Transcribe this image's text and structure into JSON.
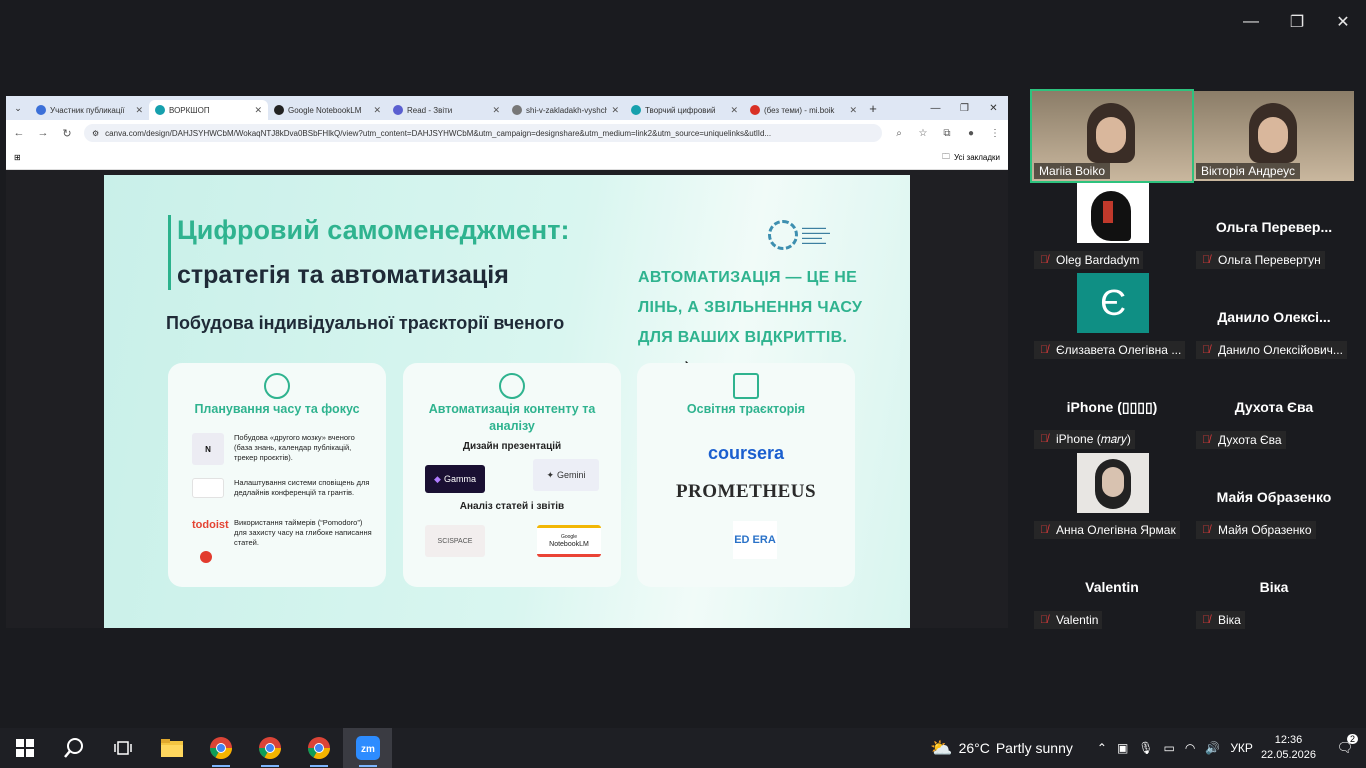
{
  "browser": {
    "tabs": [
      {
        "label": "Участник публикації",
        "color": "#3b6fd8",
        "active": false
      },
      {
        "label": "ВОРКШОП",
        "color": "#16a0ad",
        "active": true
      },
      {
        "label": "Google NotebookLM",
        "color": "#222222",
        "active": false
      },
      {
        "label": "Read - Звіти",
        "color": "#5a5fd0",
        "active": false
      },
      {
        "label": "shi-v-zakladakh-vyshch",
        "color": "#777777",
        "active": false
      },
      {
        "label": "Творчий цифровий",
        "color": "#16a0ad",
        "active": false
      },
      {
        "label": "(без теми) - mi.boik",
        "color": "#d93025",
        "active": false
      }
    ],
    "url": "canva.com/design/DAHJSYHWCbM/WokaqNTJ8kDva0BSbFHlkQ/view?utm_content=DAHJSYHWCbM&utm_campaign=designshare&utm_medium=link2&utm_source=uniquelinks&utlId...",
    "bookmarks_label": "Усі закладки"
  },
  "slide": {
    "title_line1": "Цифровий самоменеджмент:",
    "title_line2": "стратегія та автоматизація",
    "subtitle": "Побудова індивідуальної траєкторії вченого",
    "slogan": "АВТОМАТИЗАЦІЯ — ЦЕ НЕ ЛІНЬ, А ЗВІЛЬНЕННЯ ЧАСУ ДЛЯ ВАШИХ ВІДКРИТТІВ.",
    "card1": {
      "title": "Планування часу та фокус",
      "items": [
        {
          "icon_label": "N",
          "text": "Побудова «другого мозку» вченого (база знань, календар публікацій, трекер проєктів)."
        },
        {
          "icon_label": "",
          "text": "Налаштування системи сповіщень для дедлайнів конференцій та грантів."
        },
        {
          "icon_label": "todoist",
          "text": "Використання таймерів (“Pomodoro”) для захисту часу на глибоке написання статей."
        }
      ]
    },
    "card2": {
      "title": "Автоматизація контенту та аналізу",
      "section1": "Дизайн презентацій",
      "gamma": "Gamma",
      "gemini": "Gemini",
      "section2": "Аналіз статей і звітів",
      "scispace": "SCISPACE",
      "notebook": "NotebookLM",
      "notebook_small": "Google"
    },
    "card3": {
      "title": "Освітня траєкторія",
      "coursera": "coursera",
      "prometheus": "PROMETHEUS",
      "edera": "ED ERA"
    }
  },
  "participants": [
    {
      "name": "Mariia Boiko",
      "video": true,
      "active": true
    },
    {
      "name": "Вікторія Андреус",
      "video": true,
      "active": false
    },
    {
      "name": "Oleg Bardadym",
      "big": "",
      "avatar": "head"
    },
    {
      "name": "Ольга Перевертун",
      "big": "Ольга  Перевер..."
    },
    {
      "name": "Єлизавета Олегівна ...",
      "big": "",
      "avatar": "e"
    },
    {
      "name": "Данило Олексійович...",
      "big": "Данило  Олексі..."
    },
    {
      "name": "iPhone (𝑚𝑎𝑟𝑦)",
      "big": "iPhone (▯▯▯▯)"
    },
    {
      "name": "Духота Єва",
      "big": "Духота Єва"
    },
    {
      "name": "Анна Олегівна Ярмак",
      "big": "",
      "avatar": "photo"
    },
    {
      "name": "Майя Образенко",
      "big": "Майя Образенко"
    },
    {
      "name": "Valentin",
      "big": "Valentin"
    },
    {
      "name": "Віка",
      "big": "Віка"
    }
  ],
  "taskbar": {
    "weather_temp": "26°C",
    "weather_text": "Partly sunny",
    "lang": "УКР",
    "time": "12:36",
    "date": "22.05.2026",
    "notifications": "2"
  }
}
